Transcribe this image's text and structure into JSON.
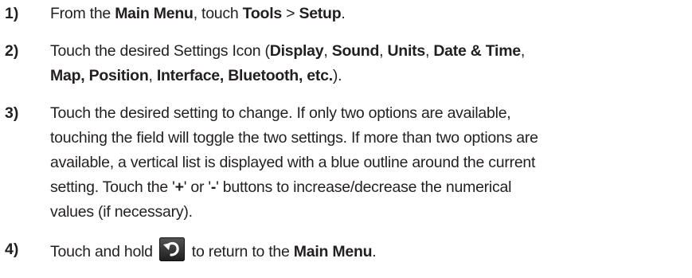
{
  "steps": [
    {
      "number": "1)",
      "t1": "From the ",
      "b1": "Main Menu",
      "t2": ", touch ",
      "b2": "Tools",
      "t3": " > ",
      "b3": "Setup",
      "t4": "."
    },
    {
      "number": "2)",
      "t1": "Touch the desired Settings Icon (",
      "b1": "Display",
      "t2": ", ",
      "b2": "Sound",
      "t3": ", ",
      "b3": "Units",
      "t4": ", ",
      "b4": "Date & Time",
      "t5": ",",
      "b5": "Map, Position",
      "t6": ", ",
      "b6": "Interface, Bluetooth, etc.",
      "t7": ")."
    },
    {
      "number": "3)",
      "line1": "Touch the desired setting to change.  If only two options are available,",
      "line2": "touching the field will toggle the two settings.  If more than two options are",
      "line3": "available, a vertical list is displayed with a blue outline around the current",
      "line4a": "setting.  Touch the '",
      "plus": "+",
      "line4b": "' or '",
      "minus": "-",
      "line4c": "' buttons to increase/decrease the numerical",
      "line5": "values (if necessary)."
    },
    {
      "number": "4)",
      "t1": "Touch and hold",
      "icon": "back-arrow-icon",
      "t2": "to return to the ",
      "b1": "Main Menu",
      "t3": "."
    }
  ],
  "colors": {
    "text": "#231f20",
    "icon_background": "#2b2b2b",
    "icon_arrow": "#ffffff"
  }
}
